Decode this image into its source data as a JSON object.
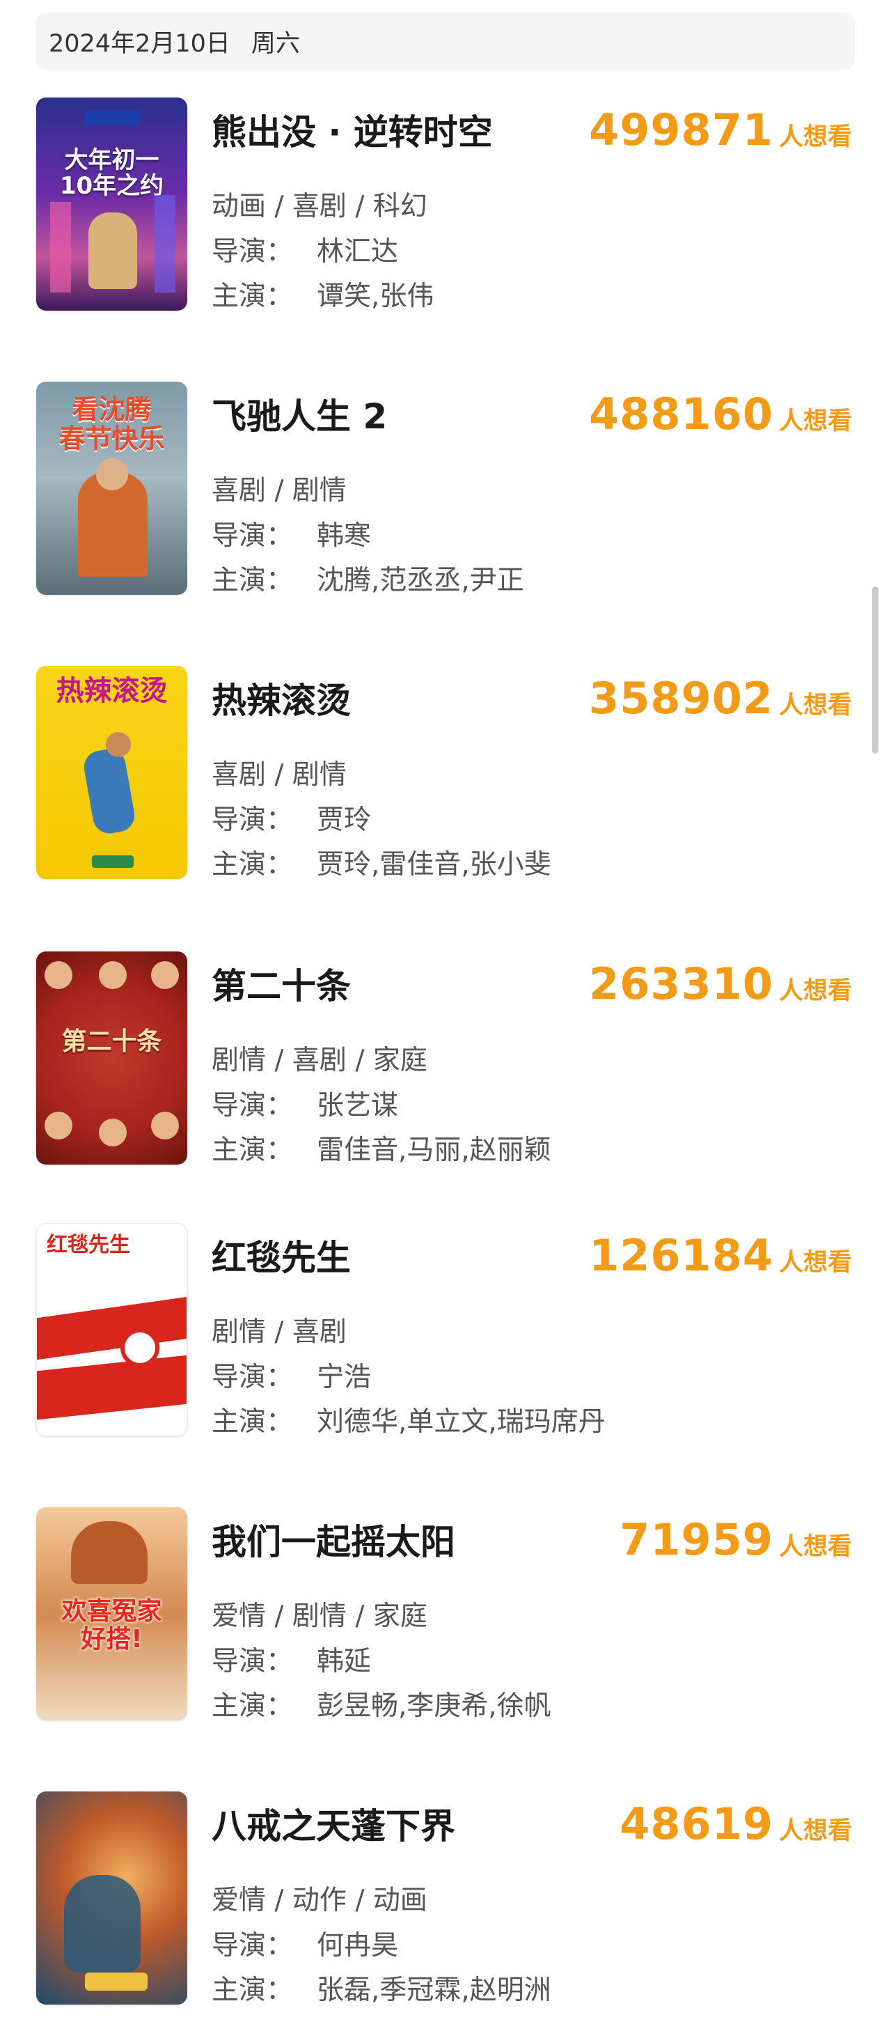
{
  "header": {
    "date": "2024年2月10日",
    "weekday": "周六"
  },
  "labels": {
    "director": "导演：",
    "cast": "主演：",
    "want": "人想看"
  },
  "colors": {
    "accent": "#f39a16",
    "background": "#ffffff",
    "date_bar": "#f5f5f5"
  },
  "movies": [
    {
      "title": "熊出没 · 逆转时空",
      "count": "499871",
      "genres": "动画 / 喜剧 / 科幻",
      "director": "林汇达",
      "cast": "谭笑,张伟",
      "poster_text": "大年初一\n10年之约",
      "poster_colors": [
        "#3b2a8c",
        "#7a2ca8",
        "#d05a9a"
      ]
    },
    {
      "title": "飞驰人生 2",
      "count": "488160",
      "genres": "喜剧 / 剧情",
      "director": "韩寒",
      "cast": "沈腾,范丞丞,尹正",
      "poster_text": "看沈腾\n春节快乐",
      "poster_colors": [
        "#5a7a8c",
        "#8fa6b0",
        "#c25a3a"
      ]
    },
    {
      "title": "热辣滚烫",
      "count": "358902",
      "genres": "喜剧 / 剧情",
      "director": "贾玲",
      "cast": "贾玲,雷佳音,张小斐",
      "poster_text": "热辣滚烫",
      "poster_colors": [
        "#f7d117",
        "#f5c800",
        "#e8b800"
      ]
    },
    {
      "title": "第二十条",
      "count": "263310",
      "genres": "剧情 / 喜剧 / 家庭",
      "director": "张艺谋",
      "cast": "雷佳音,马丽,赵丽颖",
      "poster_text": "第二十条",
      "poster_colors": [
        "#a8251c",
        "#c0392b",
        "#7a1a12"
      ]
    },
    {
      "title": "红毯先生",
      "count": "126184",
      "genres": "剧情 / 喜剧",
      "director": "宁浩",
      "cast": "刘德华,单立文,瑞玛席丹",
      "poster_text": "红毯先生",
      "poster_colors": [
        "#ffffff",
        "#f0f0f0",
        "#d8261c"
      ]
    },
    {
      "title": "我们一起摇太阳",
      "count": "71959",
      "genres": "爱情 / 剧情 / 家庭",
      "director": "韩延",
      "cast": "彭昱畅,李庚希,徐帆",
      "poster_text": "欢喜冤家\n好搭!",
      "poster_colors": [
        "#e8b08a",
        "#c9703a",
        "#f4d6b0"
      ]
    },
    {
      "title": "八戒之天蓬下界",
      "count": "48619",
      "genres": "爱情 / 动作 / 动画",
      "director": "何冉昊",
      "cast": "张磊,季冠霖,赵明洲",
      "poster_text": "",
      "poster_colors": [
        "#1f4a6e",
        "#c25a2a",
        "#e89a3a"
      ]
    }
  ]
}
